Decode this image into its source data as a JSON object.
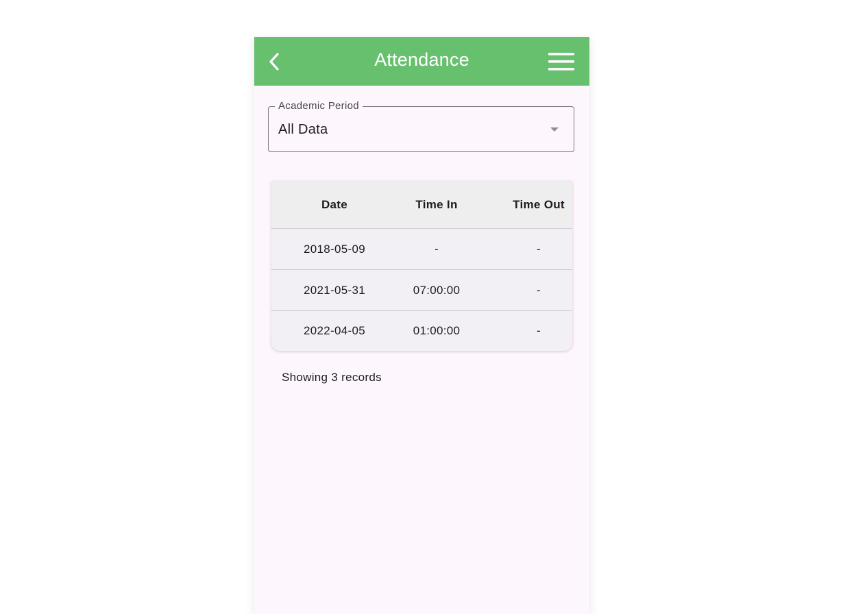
{
  "appbar": {
    "title": "Attendance",
    "back_icon": "chevron-left-icon",
    "menu_icon": "hamburger-menu-icon",
    "color": "#66c06d"
  },
  "period": {
    "label": "Academic Period",
    "value": "All Data",
    "icon": "dropdown-caret-icon"
  },
  "table": {
    "headers": [
      "Date",
      "Time In",
      "Time Out"
    ],
    "rows": [
      [
        "2018-05-09",
        "-",
        "-"
      ],
      [
        "2021-05-31",
        "07:00:00",
        "-"
      ],
      [
        "2022-04-05",
        "01:00:00",
        "-"
      ]
    ]
  },
  "footer": {
    "records_text": "Showing 3 records"
  }
}
